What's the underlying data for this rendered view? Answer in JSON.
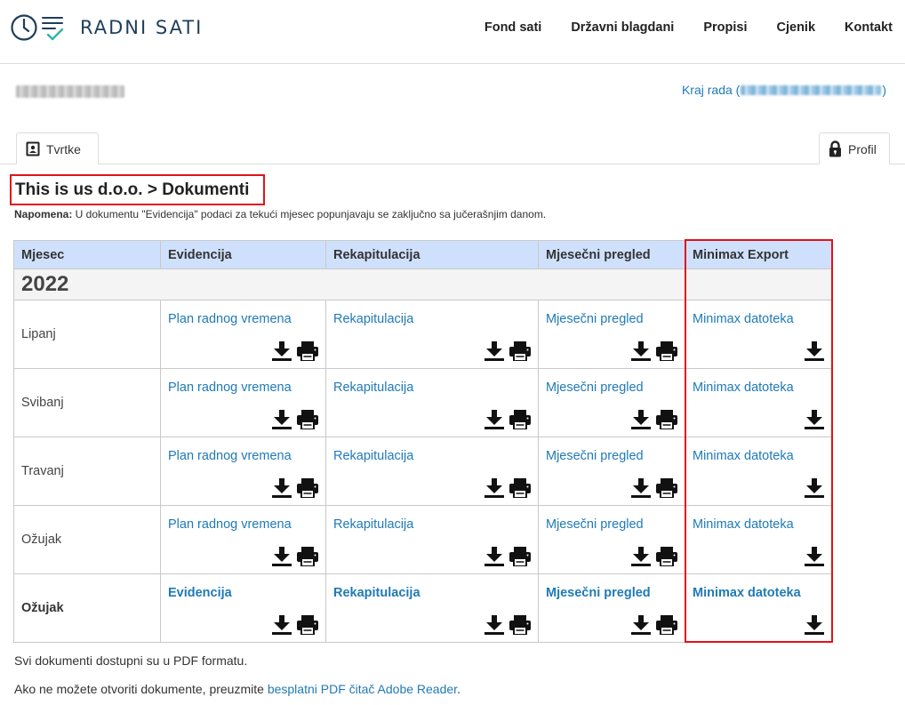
{
  "app": {
    "logo_text": "RADNI SATI",
    "nav": [
      "Fond sati",
      "Državni blagdani",
      "Propisi",
      "Cjenik",
      "Kontakt"
    ]
  },
  "session": {
    "logout_label": "Kraj rada (",
    "logout_close": ")"
  },
  "tabs": {
    "companies": "Tvrtke",
    "profile": "Profil"
  },
  "page": {
    "title": "This is us d.o.o. > Dokumenti",
    "note_label": "Napomena:",
    "note_text": " U dokumentu \"Evidencija\" podaci za tekući mjesec popunjavaju se zaključno sa jučerašnjim danom."
  },
  "table": {
    "headers": [
      "Mjesec",
      "Evidencija",
      "Rekapitulacija",
      "Mjesečni pregled",
      "Minimax Export"
    ],
    "year": "2022",
    "rows": [
      {
        "month": "Lipanj",
        "evidencija": "Plan radnog vremena",
        "rekapitulacija": "Rekapitulacija",
        "pregled": "Mjesečni pregled",
        "minimax": "Minimax datoteka"
      },
      {
        "month": "Svibanj",
        "evidencija": "Plan radnog vremena",
        "rekapitulacija": "Rekapitulacija",
        "pregled": "Mjesečni pregled",
        "minimax": "Minimax datoteka"
      },
      {
        "month": "Travanj",
        "evidencija": "Plan radnog vremena",
        "rekapitulacija": "Rekapitulacija",
        "pregled": "Mjesečni pregled",
        "minimax": "Minimax datoteka"
      },
      {
        "month": "Ožujak",
        "evidencija": "Plan radnog vremena",
        "rekapitulacija": "Rekapitulacija",
        "pregled": "Mjesečni pregled",
        "minimax": "Minimax datoteka"
      },
      {
        "month": "Ožujak",
        "evidencija": "Evidencija",
        "rekapitulacija": "Rekapitulacija",
        "pregled": "Mjesečni pregled",
        "minimax": "Minimax datoteka",
        "bold": true
      }
    ]
  },
  "footer": {
    "line1": "Svi dokumenti dostupni su u PDF formatu.",
    "line2_prefix": "Ako ne možete otvoriti dokumente, preuzmite ",
    "line2_link": "besplatni PDF čitač Adobe Reader",
    "line2_suffix": "."
  },
  "icons": {
    "logo": "clock-checklist-icon",
    "download": "download-icon",
    "print": "printer-icon",
    "companies": "contact-book-icon",
    "profile": "lock-icon"
  },
  "colors": {
    "link": "#1f7ab5",
    "header_bg": "#cfe0fc",
    "highlight": "#e0131a",
    "logo": "#1f3e5a",
    "logo_check": "#2bb8a6"
  }
}
